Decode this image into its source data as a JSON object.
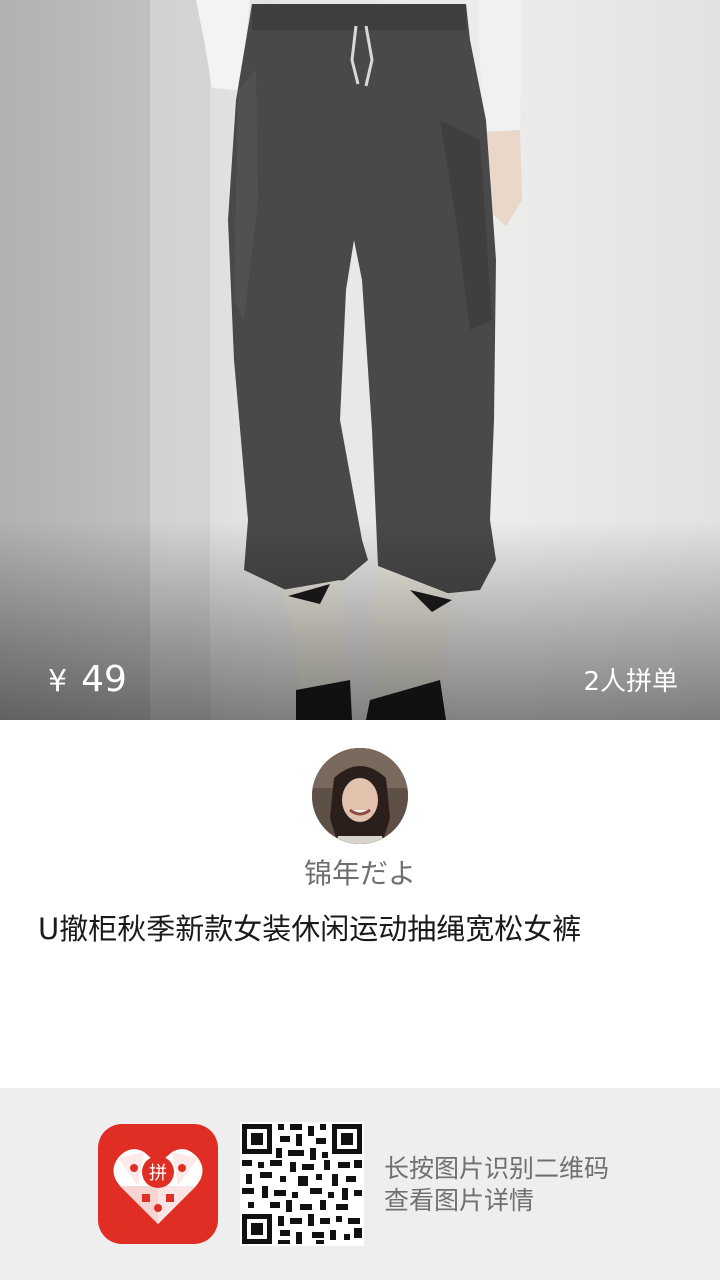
{
  "product": {
    "currency_symbol": "¥",
    "price": "49",
    "group_buy_label": "2人拼单",
    "title": "U撤柜秋季新款女装休闲运动抽绳宽松女裤"
  },
  "sharer": {
    "username": "锦年だよ"
  },
  "footer": {
    "hint_line_1": "长按图片识别二维码",
    "hint_line_2": "查看图片详情",
    "app_logo_glyph": "拼"
  },
  "colors": {
    "brand_red": "#e02e24",
    "footer_bg": "#eeeeee",
    "hint_text": "#707070"
  }
}
